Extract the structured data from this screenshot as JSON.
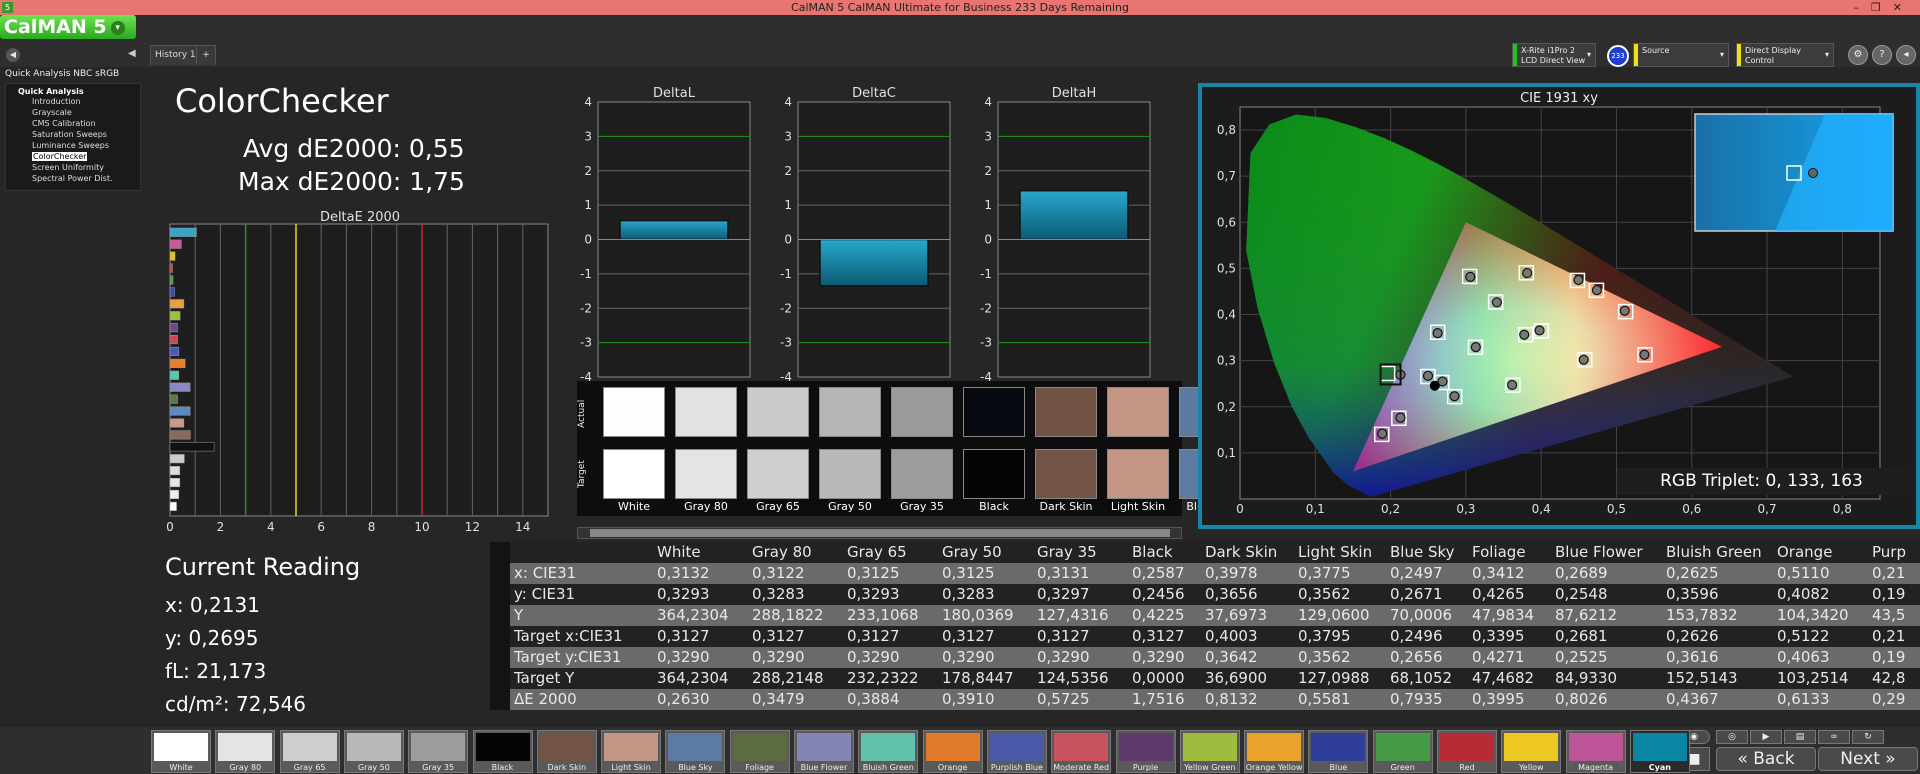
{
  "window": {
    "title": "CalMAN 5 CalMAN Ultimate for Business 233 Days Remaining",
    "app_icon": "5",
    "controls": [
      "–",
      "❐",
      "✕"
    ]
  },
  "logo": {
    "text": "CalMAN 5",
    "dropdown": "▾"
  },
  "tabs": [
    {
      "label": "History 1"
    },
    {
      "label": "+"
    }
  ],
  "devices": {
    "meter": {
      "line1": "X-Rite i1Pro 2",
      "line2": "LCD Direct View",
      "color": "#22c422"
    },
    "badge": "233",
    "source": {
      "label": "Source",
      "color": "#f0e010"
    },
    "display": {
      "label": "Direct Display Control",
      "color": "#f0e010"
    },
    "buttons": [
      "⚙",
      "?",
      "◂"
    ]
  },
  "sidebar": {
    "title": "Quick Analysis NBC sRGB",
    "root": "Quick Analysis",
    "items": [
      "Introduction",
      "Grayscale",
      "CMS Calibration",
      "Saturation Sweeps",
      "Luminance Sweeps",
      "ColorChecker",
      "Screen Uniformity",
      "Spectral Power Dist."
    ],
    "selected": "ColorChecker"
  },
  "main": {
    "heading": "ColorChecker",
    "avg": "Avg dE2000: 0,55",
    "max": "Max dE2000: 1,75"
  },
  "deltae_chart": {
    "title": "DeltaE 2000",
    "xticks": [
      "0",
      "2",
      "4",
      "6",
      "8",
      "10",
      "12",
      "14"
    ],
    "xmax": 15,
    "thresholds": [
      {
        "value": 3,
        "color": "#1c9a1c"
      },
      {
        "value": 5,
        "color": "#f0d020"
      },
      {
        "value": 10,
        "color": "#d02020"
      }
    ],
    "bars": [
      {
        "v": 1.05,
        "c": "#3aa4c8"
      },
      {
        "v": 0.45,
        "c": "#c85a9a"
      },
      {
        "v": 0.2,
        "c": "#e8c020"
      },
      {
        "v": 0.1,
        "c": "#d83a3a"
      },
      {
        "v": 0.12,
        "c": "#4aa04a"
      },
      {
        "v": 0.18,
        "c": "#3a4ab0"
      },
      {
        "v": 0.55,
        "c": "#e8a040"
      },
      {
        "v": 0.4,
        "c": "#a0c040"
      },
      {
        "v": 0.3,
        "c": "#6a4a8a"
      },
      {
        "v": 0.3,
        "c": "#c84a5a"
      },
      {
        "v": 0.35,
        "c": "#4a5ab8"
      },
      {
        "v": 0.6,
        "c": "#e88030"
      },
      {
        "v": 0.35,
        "c": "#5ac8b0"
      },
      {
        "v": 0.8,
        "c": "#8a8ac0"
      },
      {
        "v": 0.3,
        "c": "#5a7a4a"
      },
      {
        "v": 0.8,
        "c": "#5a8ac0"
      },
      {
        "v": 0.55,
        "c": "#c89a8a"
      },
      {
        "v": 0.81,
        "c": "#8a6a5a"
      },
      {
        "v": 1.75,
        "c": "#111111"
      },
      {
        "v": 0.57,
        "c": "#cccccc"
      },
      {
        "v": 0.39,
        "c": "#dddddd"
      },
      {
        "v": 0.39,
        "c": "#e5e5e5"
      },
      {
        "v": 0.35,
        "c": "#eeeeee"
      },
      {
        "v": 0.26,
        "c": "#ffffff"
      }
    ]
  },
  "delta_charts": [
    {
      "title": "DeltaL",
      "value": 0.55
    },
    {
      "title": "DeltaC",
      "value": -1.35
    },
    {
      "title": "DeltaH",
      "value": 1.42
    }
  ],
  "delta_yticks": [
    "4",
    "3",
    "2",
    "1",
    "0",
    "-1",
    "-2",
    "-3",
    "-4"
  ],
  "swatches": {
    "actual_label": "Actual",
    "target_label": "Target",
    "items": [
      {
        "name": "White",
        "actual": "#fdfdfd",
        "target": "#ffffff"
      },
      {
        "name": "Gray 80",
        "actual": "#e2e2e2",
        "target": "#e4e4e4"
      },
      {
        "name": "Gray 65",
        "actual": "#cbcbcb",
        "target": "#cfcfcf"
      },
      {
        "name": "Gray 50",
        "actual": "#b6b6b6",
        "target": "#b9b9b9"
      },
      {
        "name": "Gray 35",
        "actual": "#9c9c9c",
        "target": "#9d9d9d"
      },
      {
        "name": "Black",
        "actual": "#070a10",
        "target": "#050505"
      },
      {
        "name": "Dark Skin",
        "actual": "#715244",
        "target": "#735345"
      },
      {
        "name": "Light Skin",
        "actual": "#c29584",
        "target": "#c39685"
      },
      {
        "name": "Blue Sky",
        "actual": "#5c7aa0",
        "target": "#5d7ba2"
      }
    ]
  },
  "cie": {
    "title": "CIE 1931 xy",
    "xticks": [
      "0",
      "0,1",
      "0,2",
      "0,3",
      "0,4",
      "0,5",
      "0,6",
      "0,7",
      "0,8"
    ],
    "yticks": [
      "0,1",
      "0,2",
      "0,3",
      "0,4",
      "0,5",
      "0,6",
      "0,7",
      "0,8"
    ],
    "triplet": "RGB Triplet: 0, 133, 163",
    "targets": [
      [
        0.3127,
        0.329
      ],
      [
        0.4003,
        0.3642
      ],
      [
        0.3795,
        0.3562
      ],
      [
        0.2496,
        0.2656
      ],
      [
        0.3395,
        0.4271
      ],
      [
        0.2681,
        0.2525
      ],
      [
        0.2626,
        0.3616
      ],
      [
        0.5122,
        0.4063
      ],
      [
        0.211,
        0.1751
      ],
      [
        0.4578,
        0.3021
      ],
      [
        0.2851,
        0.2219
      ],
      [
        0.3803,
        0.4905
      ],
      [
        0.4734,
        0.4525
      ],
      [
        0.1883,
        0.1401
      ],
      [
        0.305,
        0.4826
      ],
      [
        0.5379,
        0.3127
      ],
      [
        0.4482,
        0.4739
      ],
      [
        0.3624,
        0.2468
      ],
      [
        0.1961,
        0.2722
      ]
    ],
    "actuals": [
      [
        0.3132,
        0.3293
      ],
      [
        0.3978,
        0.3656
      ],
      [
        0.3775,
        0.3562
      ],
      [
        0.2497,
        0.2671
      ],
      [
        0.3412,
        0.4265
      ],
      [
        0.2689,
        0.2548
      ],
      [
        0.2625,
        0.3596
      ],
      [
        0.511,
        0.4082
      ],
      [
        0.2131,
        0.1765
      ],
      [
        0.4565,
        0.3019
      ],
      [
        0.2849,
        0.2228
      ],
      [
        0.3814,
        0.4899
      ],
      [
        0.474,
        0.453
      ],
      [
        0.1889,
        0.1417
      ],
      [
        0.3059,
        0.4817
      ],
      [
        0.5371,
        0.3128
      ],
      [
        0.4495,
        0.4749
      ],
      [
        0.3614,
        0.2473
      ],
      [
        0.2131,
        0.2695
      ]
    ],
    "black_point": [
      0.2587,
      0.2456
    ]
  },
  "current_reading": {
    "title": "Current Reading",
    "x": "x: 0,2131",
    "y": "y: 0,2695",
    "fl": "fL: 21,173",
    "cd": "cd/m²: 72,546"
  },
  "table": {
    "columns": [
      "White",
      "Gray 80",
      "Gray 65",
      "Gray 50",
      "Gray 35",
      "Black",
      "Dark Skin",
      "Light Skin",
      "Blue Sky",
      "Foliage",
      "Blue Flower",
      "Bluish Green",
      "Orange",
      "Purp"
    ],
    "rows": [
      {
        "label": "x: CIE31",
        "values": [
          "0,3132",
          "0,3122",
          "0,3125",
          "0,3125",
          "0,3131",
          "0,2587",
          "0,3978",
          "0,3775",
          "0,2497",
          "0,3412",
          "0,2689",
          "0,2625",
          "0,5110",
          "0,21"
        ]
      },
      {
        "label": "y: CIE31",
        "values": [
          "0,3293",
          "0,3283",
          "0,3293",
          "0,3283",
          "0,3297",
          "0,2456",
          "0,3656",
          "0,3562",
          "0,2671",
          "0,4265",
          "0,2548",
          "0,3596",
          "0,4082",
          "0,19"
        ]
      },
      {
        "label": "Y",
        "values": [
          "364,2304",
          "288,1822",
          "233,1068",
          "180,0369",
          "127,4316",
          "0,4225",
          "37,6973",
          "129,0600",
          "70,0006",
          "47,9834",
          "87,6212",
          "153,7832",
          "104,3420",
          "43,5"
        ]
      },
      {
        "label": "Target x:CIE31",
        "values": [
          "0,3127",
          "0,3127",
          "0,3127",
          "0,3127",
          "0,3127",
          "0,3127",
          "0,4003",
          "0,3795",
          "0,2496",
          "0,3395",
          "0,2681",
          "0,2626",
          "0,5122",
          "0,21"
        ]
      },
      {
        "label": "Target y:CIE31",
        "values": [
          "0,3290",
          "0,3290",
          "0,3290",
          "0,3290",
          "0,3290",
          "0,3290",
          "0,3642",
          "0,3562",
          "0,2656",
          "0,4271",
          "0,2525",
          "0,3616",
          "0,4063",
          "0,19"
        ]
      },
      {
        "label": "Target Y",
        "values": [
          "364,2304",
          "288,2148",
          "232,2322",
          "178,8447",
          "124,5356",
          "0,0000",
          "36,6900",
          "127,0988",
          "68,1052",
          "47,4682",
          "84,9330",
          "152,5143",
          "103,2514",
          "42,8"
        ]
      },
      {
        "label": "ΔE 2000",
        "values": [
          "0,2630",
          "0,3479",
          "0,3884",
          "0,3910",
          "0,5725",
          "1,7516",
          "0,8132",
          "0,5581",
          "0,7935",
          "0,3995",
          "0,8026",
          "0,4367",
          "0,6133",
          "0,29"
        ]
      }
    ]
  },
  "bottom": {
    "swatches": [
      {
        "name": "White",
        "color": "#ffffff"
      },
      {
        "name": "Gray 80",
        "color": "#e4e4e4"
      },
      {
        "name": "Gray 65",
        "color": "#cfcfcf"
      },
      {
        "name": "Gray 50",
        "color": "#b9b9b9"
      },
      {
        "name": "Gray 35",
        "color": "#9d9d9d"
      },
      {
        "name": "Black",
        "color": "#050505"
      },
      {
        "name": "Dark Skin",
        "color": "#735345"
      },
      {
        "name": "Light Skin",
        "color": "#c39685"
      },
      {
        "name": "Blue Sky",
        "color": "#5d7ba2"
      },
      {
        "name": "Foliage",
        "color": "#5b6d40"
      },
      {
        "name": "Blue Flower",
        "color": "#8485b4"
      },
      {
        "name": "Bluish Green",
        "color": "#61c2ac"
      },
      {
        "name": "Orange",
        "color": "#e07b2e"
      },
      {
        "name": "Purplish Blue",
        "color": "#4b5aa8"
      },
      {
        "name": "Moderate Red",
        "color": "#c8525e"
      },
      {
        "name": "Purple",
        "color": "#5d3a6b"
      },
      {
        "name": "Yellow Green",
        "color": "#9ebc40"
      },
      {
        "name": "Orange Yellow",
        "color": "#e9a22c"
      },
      {
        "name": "Blue",
        "color": "#2f3e98"
      },
      {
        "name": "Green",
        "color": "#479b47"
      },
      {
        "name": "Red",
        "color": "#b72b34"
      },
      {
        "name": "Yellow",
        "color": "#eec822"
      },
      {
        "name": "Magenta",
        "color": "#bf5599"
      },
      {
        "name": "Cyan",
        "color": "#0a85a3"
      }
    ],
    "selected": "Cyan",
    "back_label": "Back",
    "next_label": "Next"
  }
}
